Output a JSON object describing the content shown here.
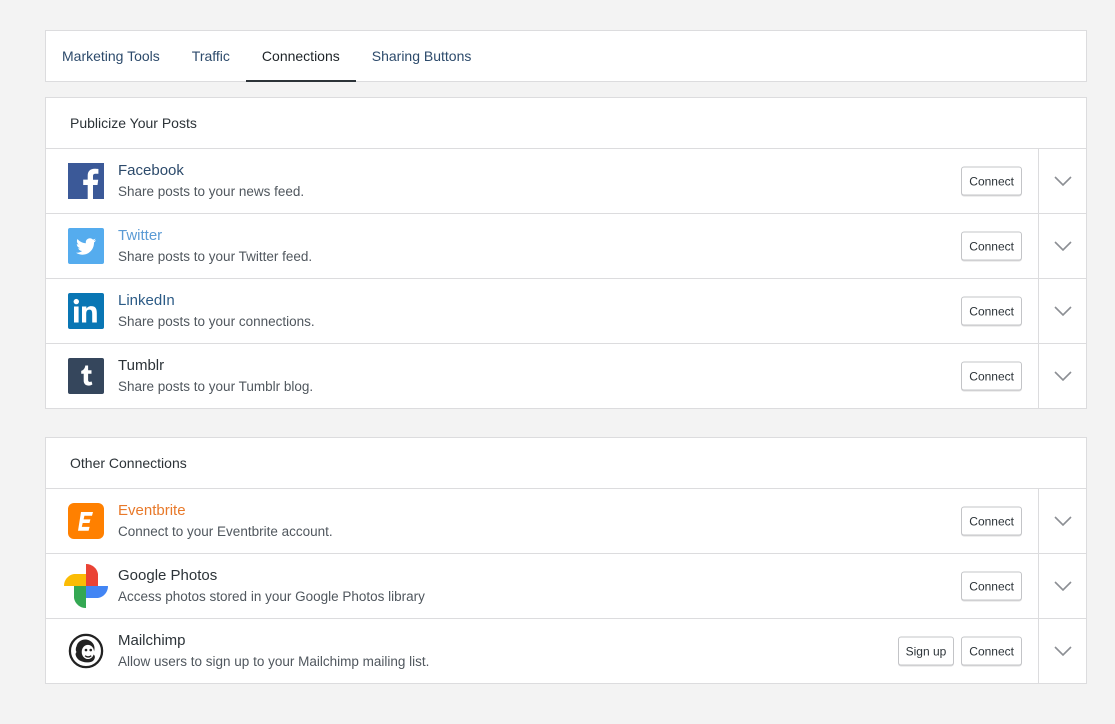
{
  "tabs": [
    {
      "label": "Marketing Tools"
    },
    {
      "label": "Traffic"
    },
    {
      "label": "Connections"
    },
    {
      "label": "Sharing Buttons"
    }
  ],
  "publicize": {
    "header": "Publicize Your Posts",
    "services": [
      {
        "name": "Facebook",
        "description": "Share posts to your news feed.",
        "name_color": "#2c4a6b",
        "icon": "facebook-icon",
        "connect_label": "Connect"
      },
      {
        "name": "Twitter",
        "description": "Share posts to your Twitter feed.",
        "name_color": "#5b9bd5",
        "icon": "twitter-icon",
        "connect_label": "Connect"
      },
      {
        "name": "LinkedIn",
        "description": "Share posts to your connections.",
        "name_color": "#2c5b86",
        "icon": "linkedin-icon",
        "connect_label": "Connect"
      },
      {
        "name": "Tumblr",
        "description": "Share posts to your Tumblr blog.",
        "name_color": "#2c3338",
        "icon": "tumblr-icon",
        "connect_label": "Connect"
      }
    ]
  },
  "other": {
    "header": "Other Connections",
    "services": [
      {
        "name": "Eventbrite",
        "description": "Connect to your Eventbrite account.",
        "name_color": "#e8792a",
        "icon": "eventbrite-icon",
        "connect_label": "Connect"
      },
      {
        "name": "Google Photos",
        "description": "Access photos stored in your Google Photos library",
        "name_color": "#2c3338",
        "icon": "google-photos-icon",
        "connect_label": "Connect"
      },
      {
        "name": "Mailchimp",
        "description": "Allow users to sign up to your Mailchimp mailing list.",
        "name_color": "#2c3338",
        "icon": "mailchimp-icon",
        "signup_label": "Sign up",
        "connect_label": "Connect"
      }
    ]
  },
  "colors": {
    "facebook": "#3b5998",
    "twitter": "#55acee",
    "linkedin": "#0976b4",
    "tumblr": "#35465c",
    "eventbrite": "#ff8000"
  }
}
